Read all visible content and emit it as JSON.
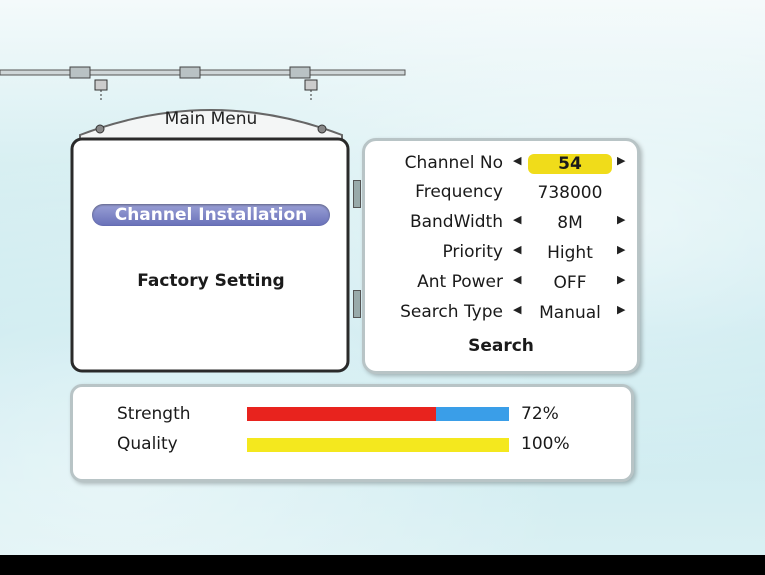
{
  "main_menu": {
    "title": "Main Menu",
    "items": [
      {
        "label": "Channel Installation",
        "selected": true
      },
      {
        "label": "Factory Setting",
        "selected": false
      }
    ]
  },
  "settings": {
    "rows": [
      {
        "label": "Channel No",
        "value": "54",
        "has_arrows": true,
        "highlighted": true
      },
      {
        "label": "Frequency",
        "value": "738000",
        "has_arrows": false,
        "highlighted": false
      },
      {
        "label": "BandWidth",
        "value": "8M",
        "has_arrows": true,
        "highlighted": false
      },
      {
        "label": "Priority",
        "value": "Hight",
        "has_arrows": true,
        "highlighted": false
      },
      {
        "label": "Ant Power",
        "value": "OFF",
        "has_arrows": true,
        "highlighted": false
      },
      {
        "label": "Search Type",
        "value": "Manual",
        "has_arrows": true,
        "highlighted": false
      }
    ],
    "search_label": "Search"
  },
  "signal": {
    "strength": {
      "label": "Strength",
      "value_text": "72%",
      "level": 0.72
    },
    "quality": {
      "label": "Quality",
      "value_text": "100%",
      "level": 1.0
    }
  },
  "colors": {
    "highlight": "#f0dc1a",
    "selected_item": "#6870b8",
    "strength_fill": "#e8231e",
    "strength_track": "#3a9ee8",
    "quality_fill": "#f4e81e"
  },
  "icons": {
    "left_arrow": "triangle-left-icon",
    "right_arrow": "triangle-right-icon"
  }
}
